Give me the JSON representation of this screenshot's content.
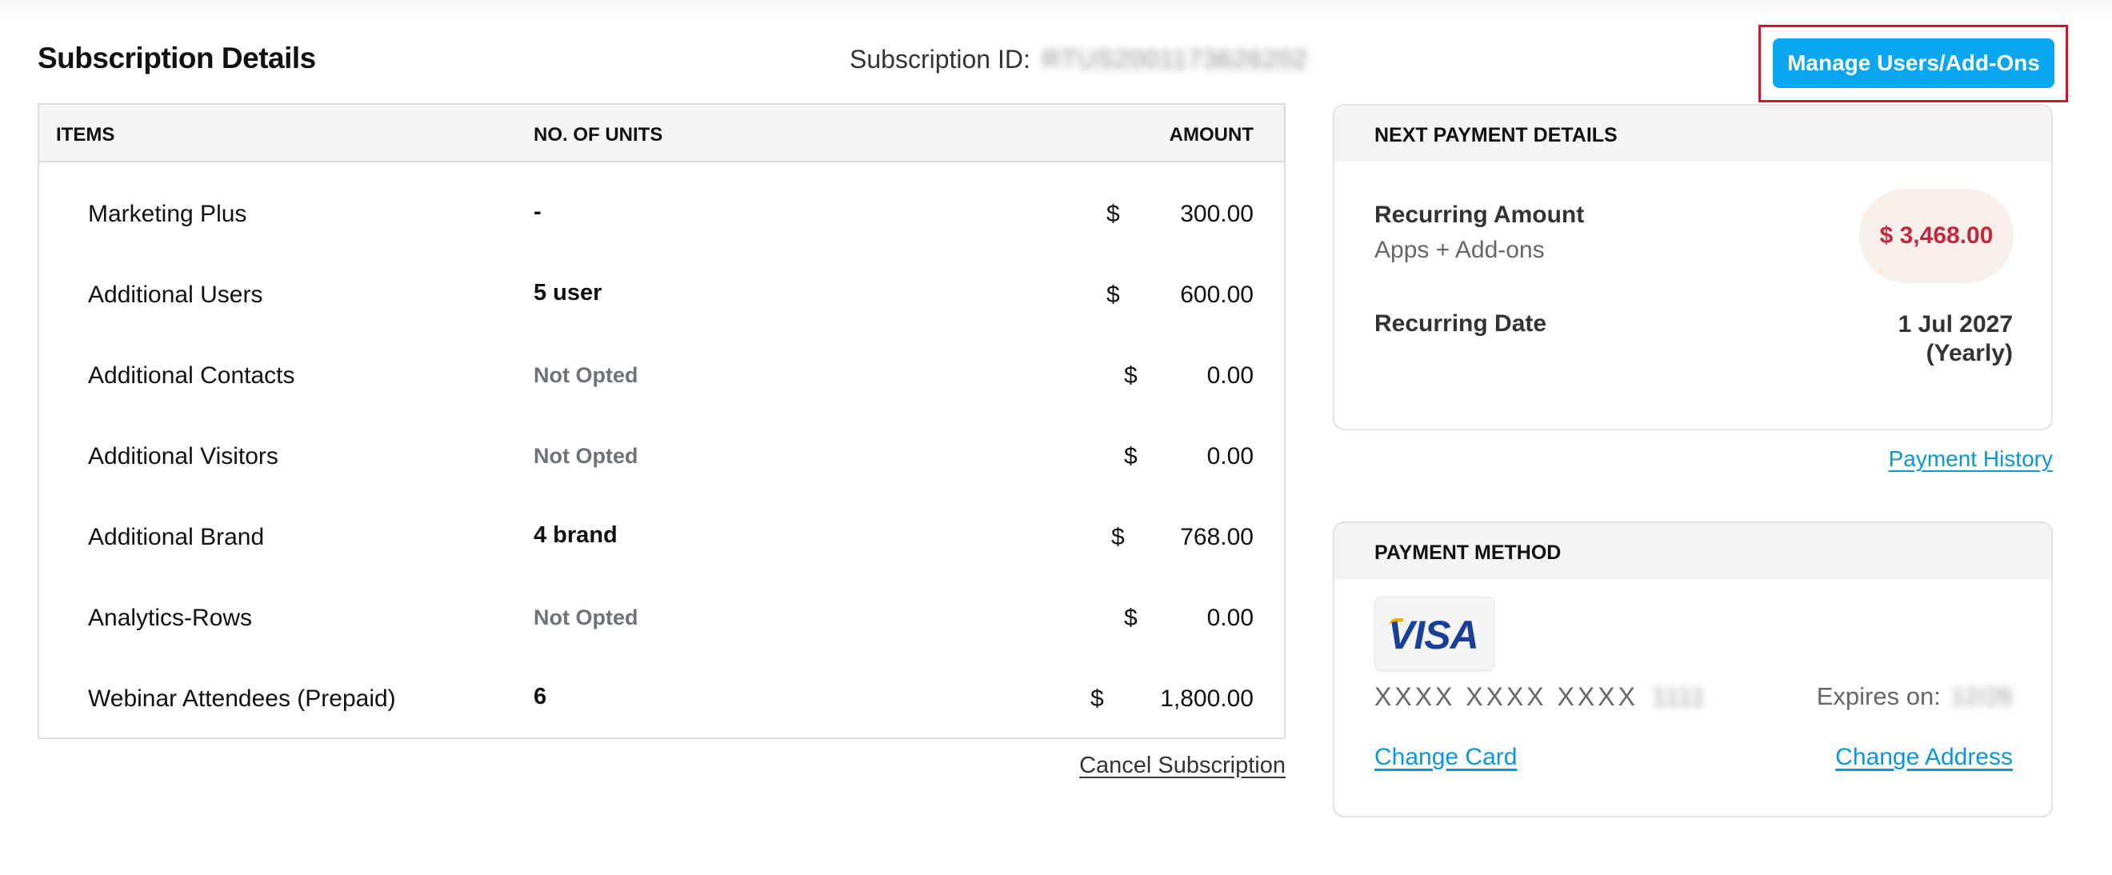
{
  "header": {
    "title": "Subscription Details",
    "subscription_id_label": "Subscription ID:",
    "subscription_id_value": "RTUS2001173626202",
    "manage_button": "Manage Users/Add-Ons",
    "highlight_color": "#d0182a",
    "accent_color": "#0aa6ef"
  },
  "items_table": {
    "columns": {
      "items": "ITEMS",
      "units": "NO. OF UNITS",
      "amount": "AMOUNT"
    },
    "rows": [
      {
        "name": "Marketing Plus",
        "units": "-",
        "units_muted": false,
        "currency": "$",
        "amount": "300.00"
      },
      {
        "name": "Additional Users",
        "units": "5 user",
        "units_muted": false,
        "currency": "$",
        "amount": "600.00"
      },
      {
        "name": "Additional Contacts",
        "units": "Not Opted",
        "units_muted": true,
        "currency": "$",
        "amount": "0.00"
      },
      {
        "name": "Additional Visitors",
        "units": "Not Opted",
        "units_muted": true,
        "currency": "$",
        "amount": "0.00"
      },
      {
        "name": "Additional Brand",
        "units": "4 brand",
        "units_muted": false,
        "currency": "$",
        "amount": "768.00"
      },
      {
        "name": "Analytics-Rows",
        "units": "Not Opted",
        "units_muted": true,
        "currency": "$",
        "amount": "0.00"
      },
      {
        "name": "Webinar Attendees (Prepaid)",
        "units": "6",
        "units_muted": false,
        "currency": "$",
        "amount": "1,800.00"
      }
    ],
    "cancel_link": "Cancel Subscription"
  },
  "next_payment": {
    "heading": "NEXT PAYMENT DETAILS",
    "recurring_amount_label": "Recurring Amount",
    "recurring_amount_sub": "Apps + Add-ons",
    "recurring_amount_value": "$ 3,468.00",
    "recurring_amount_color": "#c2273f",
    "recurring_date_label": "Recurring Date",
    "recurring_date_value": "1 Jul 2027",
    "recurring_period": "(Yearly)",
    "payment_history_link": "Payment History"
  },
  "payment_method": {
    "heading": "PAYMENT METHOD",
    "card_brand": "VISA",
    "card_number_masked": "XXXX XXXX XXXX",
    "card_number_last4": "1111",
    "expires_label": "Expires on:",
    "expires_value": "12/26",
    "change_card_link": "Change Card",
    "change_address_link": "Change Address",
    "link_color": "#0a96dd"
  }
}
